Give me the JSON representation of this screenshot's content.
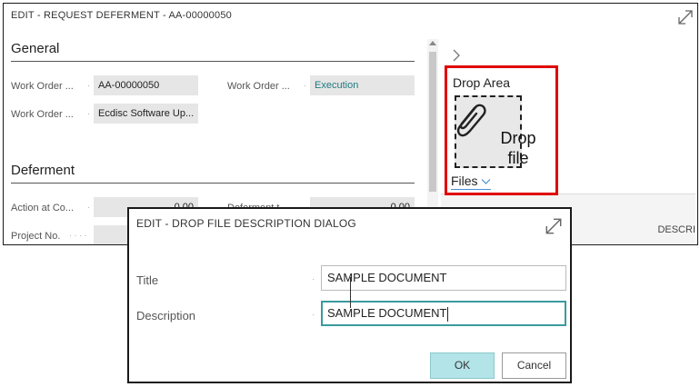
{
  "back_window": {
    "title": "EDIT - REQUEST DEFERMENT - AA-00000050",
    "general": {
      "heading": "General",
      "fields": [
        {
          "label": "Work Order ...",
          "value": "AA-00000050"
        },
        {
          "label": "Work Order ...",
          "value": "Execution"
        },
        {
          "label": "Work Order ...",
          "value": "Ecdisc Software Up..."
        }
      ]
    },
    "deferment": {
      "heading": "Deferment",
      "fields": [
        {
          "label": "Action at Co...",
          "value": "0.00"
        },
        {
          "label": "Deferment t...",
          "value": "0.00"
        },
        {
          "label": "Project No.",
          "value": ""
        }
      ]
    },
    "factbox": {
      "drop_area_title": "Drop Area",
      "drop_text": "Drop file",
      "files_label": "Files",
      "column_header": "DESCRI"
    }
  },
  "dialog": {
    "title": "EDIT - DROP FILE DESCRIPTION DIALOG",
    "fields": [
      {
        "label": "Title",
        "value": "SAMPLE DOCUMENT"
      },
      {
        "label": "Description",
        "value": "SAMPLE DOCUMENT"
      }
    ],
    "ok_label": "OK",
    "cancel_label": "Cancel"
  },
  "colors": {
    "accent_link": "#1e7a80",
    "ok_button": "#b2e4e8",
    "highlight_frame": "#e00000",
    "focus_border": "#3a9a9e"
  },
  "icons": [
    "expand-icon",
    "chevron-right-icon",
    "paperclip-icon",
    "chevron-down-icon",
    "scroll-up-icon"
  ]
}
